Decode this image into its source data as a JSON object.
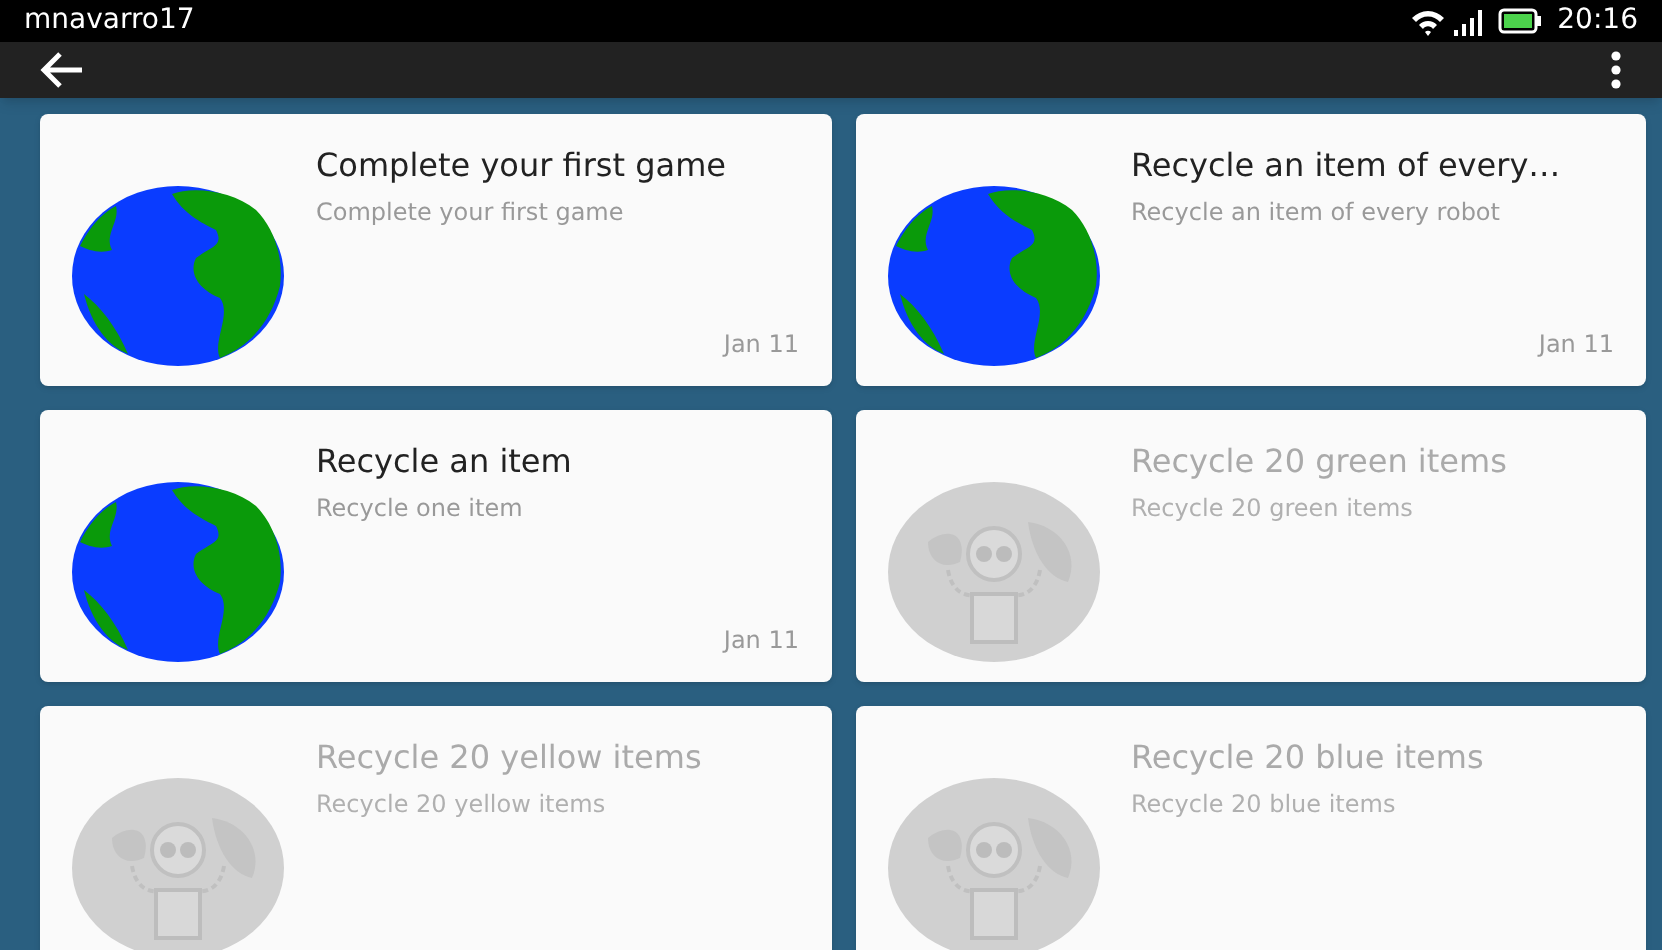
{
  "status_bar": {
    "user": "mnavarro17",
    "time": "20:16"
  },
  "achievements": [
    {
      "title": "Complete your first game",
      "description": "Complete your first game",
      "unlocked": true,
      "date": "Jan 11"
    },
    {
      "title": "Recycle an item of every…",
      "description": "Recycle an item of every robot",
      "unlocked": true,
      "date": "Jan 11"
    },
    {
      "title": "Recycle an item",
      "description": "Recycle one item",
      "unlocked": true,
      "date": "Jan 11"
    },
    {
      "title": "Recycle 20 green items",
      "description": "Recycle 20 green items",
      "unlocked": false
    },
    {
      "title": "Recycle 20 yellow items",
      "description": "Recycle 20 yellow items",
      "unlocked": false
    },
    {
      "title": "Recycle 20 blue items",
      "description": "Recycle 20 blue items",
      "unlocked": false
    }
  ]
}
